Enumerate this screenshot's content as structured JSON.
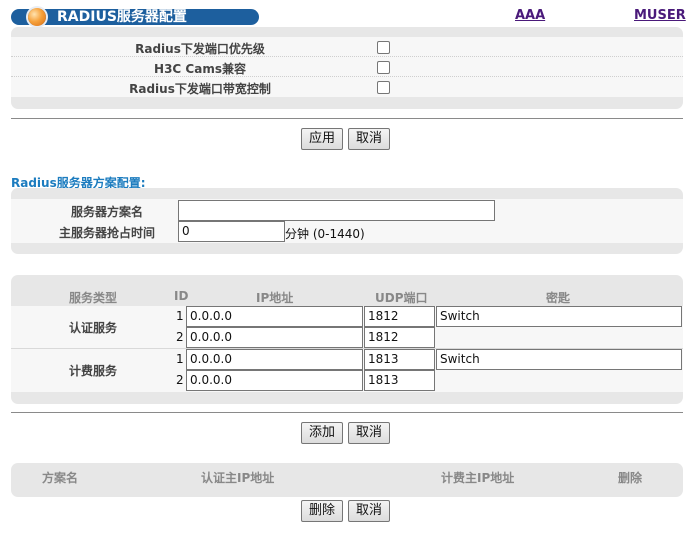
{
  "header": {
    "title": "RADIUS服务器配置",
    "links": [
      "AAA",
      "MUSER"
    ]
  },
  "global_options": {
    "rows": [
      {
        "label": "Radius下发端口优先级",
        "checked": false
      },
      {
        "label": "H3C Cams兼容",
        "checked": false
      },
      {
        "label": "Radius下发端口带宽控制",
        "checked": false
      }
    ]
  },
  "buttons": {
    "apply": "应用",
    "cancel": "取消",
    "add": "添加",
    "delete": "删除"
  },
  "scheme": {
    "section_title": "Radius服务器方案配置:",
    "name_label": "服务器方案名",
    "name_value": "",
    "preempt_label": "主服务器抢占时间",
    "preempt_value": "0",
    "preempt_unit": "分钟 (0-1440)"
  },
  "servers": {
    "headers": {
      "type": "服务类型",
      "id": "ID",
      "ip": "IP地址",
      "port": "UDP端口",
      "key": "密匙"
    },
    "auth_label": "认证服务",
    "acct_label": "计费服务",
    "auth": [
      {
        "id": "1",
        "ip": "0.0.0.0",
        "port": "1812",
        "key": "Switch"
      },
      {
        "id": "2",
        "ip": "0.0.0.0",
        "port": "1812",
        "key": ""
      }
    ],
    "acct": [
      {
        "id": "1",
        "ip": "0.0.0.0",
        "port": "1813",
        "key": "Switch"
      },
      {
        "id": "2",
        "ip": "0.0.0.0",
        "port": "1813",
        "key": ""
      }
    ]
  },
  "scheme_list": {
    "headers": {
      "name": "方案名",
      "auth_ip": "认证主IP地址",
      "acct_ip": "计费主IP地址",
      "delete": "删除"
    }
  },
  "colors": {
    "title_bar": "#1d5f9e",
    "section_title": "#1c7cbf",
    "link": "#4a1a7a",
    "panel": "#e7e7e7"
  }
}
